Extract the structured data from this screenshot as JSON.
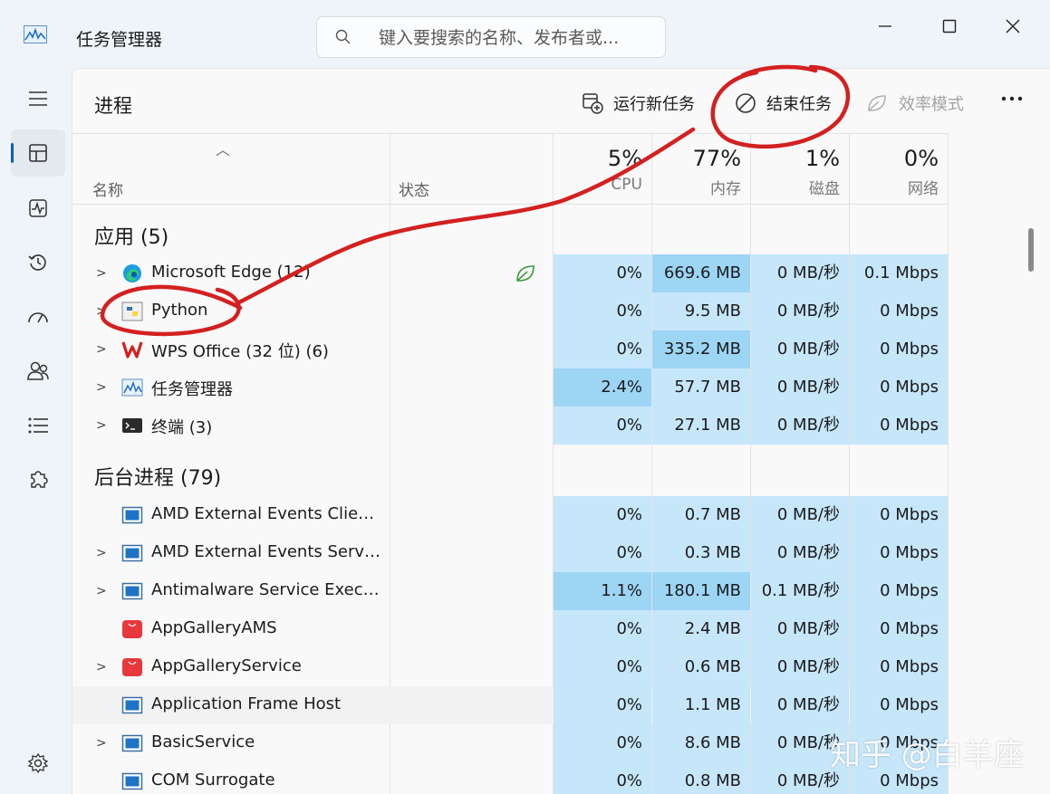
{
  "window": {
    "title": "任务管理器"
  },
  "search": {
    "placeholder": "键入要搜索的名称、发布者或..."
  },
  "page": {
    "title": "进程"
  },
  "toolbar": {
    "run_new_task": "运行新任务",
    "end_task": "结束任务",
    "efficiency_mode": "效率模式"
  },
  "columns": {
    "name": "名称",
    "status": "状态",
    "cpu": {
      "pct": "5%",
      "label": "CPU"
    },
    "memory": {
      "pct": "77%",
      "label": "内存"
    },
    "disk": {
      "pct": "1%",
      "label": "磁盘"
    },
    "network": {
      "pct": "0%",
      "label": "网络"
    }
  },
  "groups": {
    "apps": {
      "title": "应用 (5)"
    },
    "background": {
      "title": "后台进程 (79)"
    }
  },
  "apps": [
    {
      "name": "Microsoft Edge (12)",
      "icon": "edge-icon",
      "cpu": "0%",
      "mem": "669.6 MB",
      "disk": "0 MB/秒",
      "net": "0.1 Mbps",
      "efficiency": true
    },
    {
      "name": "Python",
      "icon": "python-icon",
      "cpu": "0%",
      "mem": "9.5 MB",
      "disk": "0 MB/秒",
      "net": "0 Mbps"
    },
    {
      "name": "WPS Office (32 位) (6)",
      "icon": "wps-icon",
      "cpu": "0%",
      "mem": "335.2 MB",
      "disk": "0 MB/秒",
      "net": "0 Mbps"
    },
    {
      "name": "任务管理器",
      "icon": "task-manager-icon",
      "cpu": "2.4%",
      "mem": "57.7 MB",
      "disk": "0 MB/秒",
      "net": "0 Mbps"
    },
    {
      "name": "终端 (3)",
      "icon": "terminal-icon",
      "cpu": "0%",
      "mem": "27.1 MB",
      "disk": "0 MB/秒",
      "net": "0 Mbps"
    }
  ],
  "background": [
    {
      "name": "AMD External Events Client ...",
      "icon": "service-icon",
      "cpu": "0%",
      "mem": "0.7 MB",
      "disk": "0 MB/秒",
      "net": "0 Mbps"
    },
    {
      "name": "AMD External Events Servic...",
      "icon": "service-icon",
      "cpu": "0%",
      "mem": "0.3 MB",
      "disk": "0 MB/秒",
      "net": "0 Mbps"
    },
    {
      "name": "Antimalware Service Execut...",
      "icon": "service-icon",
      "cpu": "1.1%",
      "mem": "180.1 MB",
      "disk": "0.1 MB/秒",
      "net": "0 Mbps"
    },
    {
      "name": "AppGalleryAMS",
      "icon": "huawei-icon",
      "cpu": "0%",
      "mem": "2.4 MB",
      "disk": "0 MB/秒",
      "net": "0 Mbps"
    },
    {
      "name": "AppGalleryService",
      "icon": "huawei-icon",
      "cpu": "0%",
      "mem": "0.6 MB",
      "disk": "0 MB/秒",
      "net": "0 Mbps"
    },
    {
      "name": "Application Frame Host",
      "icon": "service-icon",
      "cpu": "0%",
      "mem": "1.1 MB",
      "disk": "0 MB/秒",
      "net": "0 Mbps"
    },
    {
      "name": "BasicService",
      "icon": "service-icon",
      "cpu": "0%",
      "mem": "8.6 MB",
      "disk": "0 MB/秒",
      "net": "0 Mbps"
    },
    {
      "name": "COM Surrogate",
      "icon": "service-icon",
      "cpu": "0%",
      "mem": "0.8 MB",
      "disk": "0 MB/秒",
      "net": "0 Mbps"
    }
  ],
  "watermark": "知乎 @白羊座",
  "colors": {
    "metric_bg": "#c6e6fa",
    "metric_hot": "#9dd5f5",
    "annotation_red": "#d42020",
    "accent": "#005fb8"
  }
}
